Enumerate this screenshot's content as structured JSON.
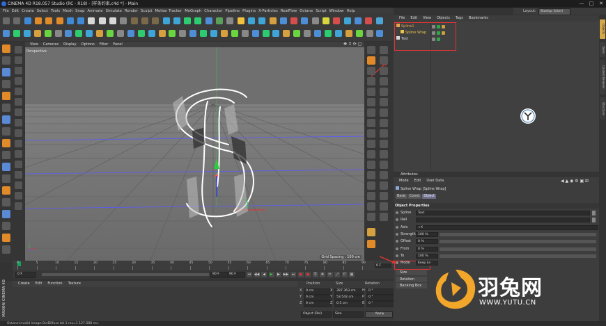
{
  "window": {
    "title": "CINEMA 4D R18.057 Studio (RC - R18) - [样条约束.c4d *] - Main",
    "controls": [
      "—",
      "□",
      "✕"
    ]
  },
  "menubar": [
    "File",
    "Edit",
    "Create",
    "Select",
    "Tools",
    "Mesh",
    "Snap",
    "Animate",
    "Simulate",
    "Render",
    "Sculpt",
    "Motion Tracker",
    "MoGraph",
    "Character",
    "Pipeline",
    "Plugins",
    "X-Particles",
    "RealFlow",
    "Octane",
    "Script",
    "Window",
    "Help"
  ],
  "layout": {
    "label": "Layout:",
    "value": "Startup (User)"
  },
  "viewport": {
    "menu": [
      "View",
      "Cameras",
      "Display",
      "Options",
      "Filter",
      "Panel"
    ],
    "camera": "Perspective",
    "grid_spacing": "Grid Spacing : 100 cm"
  },
  "timeline": {
    "ticks": [
      "0",
      "5",
      "10",
      "15",
      "20",
      "25",
      "30",
      "35",
      "40",
      "45",
      "50",
      "55",
      "60",
      "65",
      "70",
      "75",
      "80",
      "85",
      "90"
    ],
    "current_frame": "0 F",
    "start_frame": "0 F",
    "end_frame": "90 F",
    "end_field": "90 F"
  },
  "material_manager": {
    "menu": [
      "Create",
      "Edit",
      "Function",
      "Texture"
    ]
  },
  "coordinates": {
    "headers": [
      "Position",
      "Size",
      "Rotation"
    ],
    "rows": [
      {
        "axis": "X",
        "pos": "0 cm",
        "size": "397.363 cm",
        "rot_axis": "H",
        "rot": "0 °"
      },
      {
        "axis": "Y",
        "pos": "0 cm",
        "size": "53.542 cm",
        "rot_axis": "P",
        "rot": "0 °"
      },
      {
        "axis": "Z",
        "pos": "0 cm",
        "size": "0.5 cm",
        "rot_axis": "B",
        "rot": "0 °"
      }
    ],
    "mode_select": "Object (Rel)",
    "size_select": "Size",
    "apply_label": "Apply"
  },
  "object_manager": {
    "menu": [
      "File",
      "Edit",
      "View",
      "Objects",
      "Tags",
      "Bookmarks"
    ],
    "objects": [
      {
        "name": "Spline1",
        "color": "#e8a44a"
      },
      {
        "name": "Spline Wrap",
        "color": "#e8c44a"
      },
      {
        "name": "Text",
        "color": "#d8d8d8"
      }
    ]
  },
  "side_tabs": [
    "Objects",
    "Takes",
    "Content Browser",
    "Structure"
  ],
  "attributes": {
    "title": "Attributes",
    "menu": [
      "Mode",
      "Edit",
      "User Data"
    ],
    "object_label": "Spline Wrap [Spline Wrap]",
    "tabs": [
      "Basic",
      "Coord.",
      "Object"
    ],
    "active_tab": "Object",
    "section": "Object Properties",
    "props": [
      {
        "label": "Spline",
        "value": "Text",
        "bar": false
      },
      {
        "label": "Rail",
        "value": "",
        "bar": false
      },
      {
        "label": "Axis",
        "value": "+X",
        "bar": false
      },
      {
        "label": "Strength",
        "value": "100 %",
        "bar": true
      },
      {
        "label": "Offset",
        "value": "0 %",
        "bar": true
      },
      {
        "label": "From",
        "value": "0 %",
        "bar": true
      },
      {
        "label": "To",
        "value": "100 %",
        "bar": true
      },
      {
        "label": "Mode",
        "value": "Keep Le",
        "bar": false
      }
    ],
    "collapsed": [
      "Size",
      "Rotation",
      "Banking Box"
    ]
  },
  "status": "Octane:Invalid image:OctDiffuse bit 1 res=1 127.588 ms.",
  "watermark": {
    "name_cn": "羽兔网",
    "url": "WWW.YUTU.CN"
  },
  "colors": {
    "accent_red": "#e53333",
    "object_orange": "#e8a44a",
    "active_tab": "#6b6b8a"
  }
}
